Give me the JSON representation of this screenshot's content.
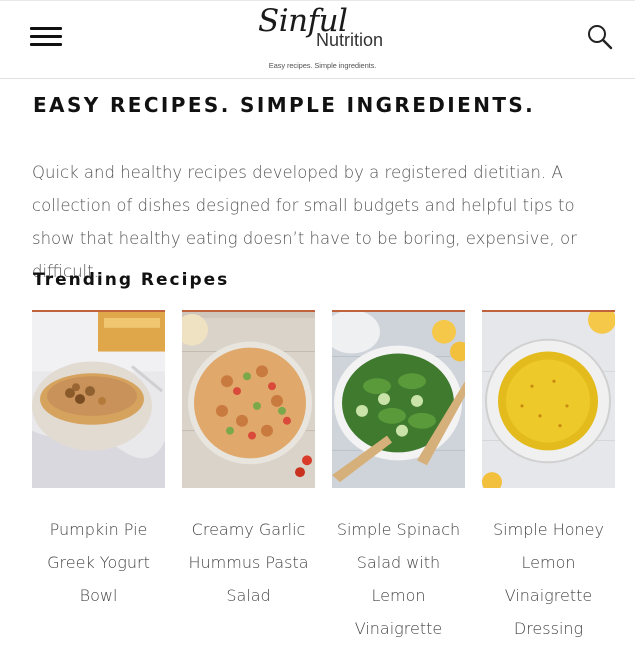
{
  "header": {
    "logo_script": "Sinful",
    "logo_sub": "Nutrition",
    "logo_tagline": "Easy recipes. Simple ingredients.",
    "menu_icon": "hamburger-menu-icon",
    "search_icon": "search-icon"
  },
  "hero": {
    "title": "EASY RECIPES. SIMPLE INGREDIENTS.",
    "intro": "Quick and healthy recipes developed by a registered dietitian. A collection of dishes designed for small budgets and helpful tips to show that healthy eating doesn’t have to be boring, expensive, or difficult."
  },
  "trending": {
    "title": "Trending Recipes",
    "items": [
      {
        "title": "Pumpkin Pie Greek Yogurt Bowl"
      },
      {
        "title": "Creamy Garlic Hummus Pasta Salad"
      },
      {
        "title": "Simple Spinach Salad with Lemon Vinaigrette"
      },
      {
        "title": "Simple Honey Lemon Vinaigrette Dressing"
      }
    ]
  },
  "colors": {
    "card_accent": "#c0623d",
    "body_text": "#555555",
    "heading": "#111111"
  }
}
